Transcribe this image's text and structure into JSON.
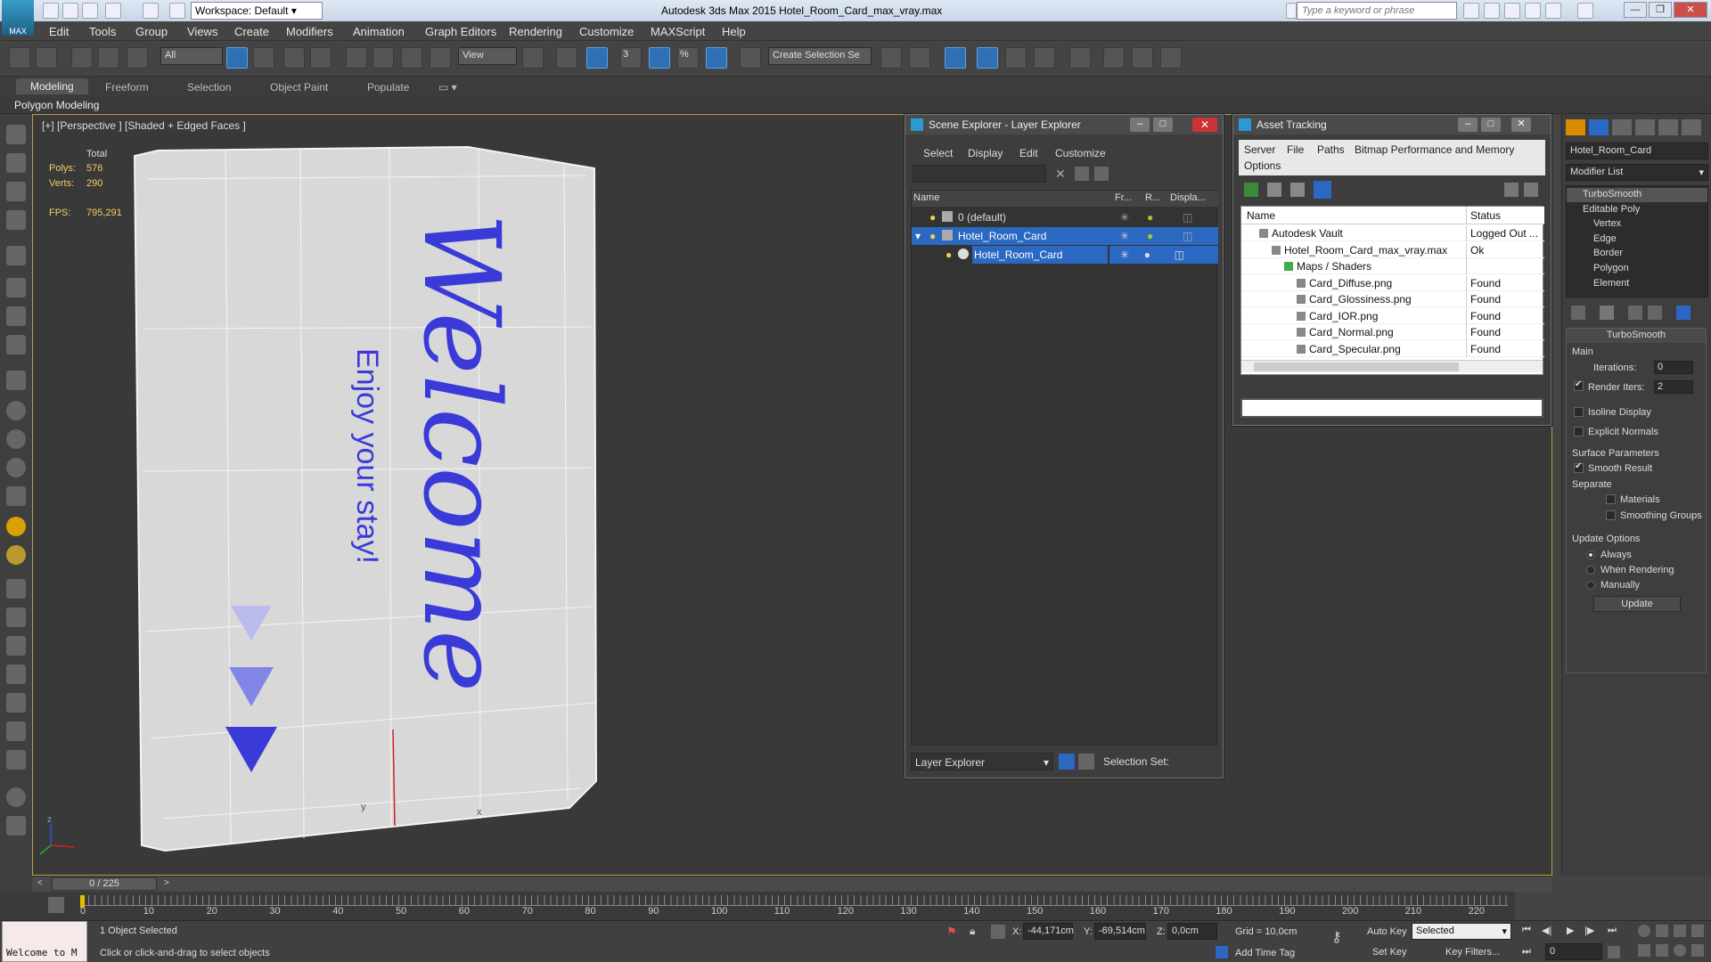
{
  "app": {
    "title": "Autodesk 3ds Max 2015    Hotel_Room_Card_max_vray.max",
    "logo": "MAX",
    "workspace": "Workspace: Default",
    "search_placeholder": "Type a keyword or phrase"
  },
  "menubar": [
    "Edit",
    "Tools",
    "Group",
    "Views",
    "Create",
    "Modifiers",
    "Animation",
    "Graph Editors",
    "Rendering",
    "Customize",
    "MAXScript",
    "Help"
  ],
  "toolbar": {
    "filter": "All",
    "refcoord": "View",
    "snaps": [
      "3",
      "%"
    ],
    "named_sel": "Create Selection Se"
  },
  "ribbon": {
    "tabs": [
      "Modeling",
      "Freeform",
      "Selection",
      "Object Paint",
      "Populate"
    ],
    "active": "Modeling",
    "panel": "Polygon Modeling"
  },
  "viewport": {
    "label": "[+] [Perspective ] [Shaded + Edged Faces ]",
    "stats": {
      "total_label": "Total",
      "polys_label": "Polys:",
      "polys": "576",
      "verts_label": "Verts:",
      "verts": "290",
      "fps_label": "FPS:",
      "fps": "795,291"
    },
    "card": {
      "title": "Welcome",
      "subtitle": "Enjoy your stay!",
      "accent": "#3a3ad8"
    },
    "axis": {
      "x": "x",
      "y": "y",
      "z": "z"
    }
  },
  "scene_explorer": {
    "title": "Scene Explorer - Layer Explorer",
    "menu": [
      "Select",
      "Display",
      "Edit",
      "Customize"
    ],
    "columns": [
      "Name",
      "Fr...",
      "R...",
      "Displa..."
    ],
    "rows": [
      {
        "name": "0 (default)",
        "level": 0,
        "selected": false
      },
      {
        "name": "Hotel_Room_Card",
        "level": 0,
        "selected": true
      },
      {
        "name": "Hotel_Room_Card",
        "level": 1,
        "selected": true
      }
    ],
    "footer_mode": "Layer Explorer",
    "footer_sel": "Selection Set:"
  },
  "asset_tracking": {
    "title": "Asset Tracking",
    "menu": [
      "Server",
      "File",
      "Paths",
      "Bitmap Performance and Memory",
      "Options"
    ],
    "columns": [
      "Name",
      "Status"
    ],
    "rows": [
      {
        "name": "Autodesk Vault",
        "status": "Logged Out ...",
        "level": 0
      },
      {
        "name": "Hotel_Room_Card_max_vray.max",
        "status": "Ok",
        "level": 1
      },
      {
        "name": "Maps / Shaders",
        "status": "",
        "level": 2
      },
      {
        "name": "Card_Diffuse.png",
        "status": "Found",
        "level": 3
      },
      {
        "name": "Card_Glossiness.png",
        "status": "Found",
        "level": 3
      },
      {
        "name": "Card_IOR.png",
        "status": "Found",
        "level": 3
      },
      {
        "name": "Card_Normal.png",
        "status": "Found",
        "level": 3
      },
      {
        "name": "Card_Specular.png",
        "status": "Found",
        "level": 3
      }
    ]
  },
  "command_panel": {
    "object_name": "Hotel_Room_Card",
    "modifier_list": "Modifier List",
    "stack": [
      "TurboSmooth",
      "Editable Poly",
      "Vertex",
      "Edge",
      "Border",
      "Polygon",
      "Element"
    ],
    "rollout_title": "TurboSmooth",
    "main_label": "Main",
    "iterations_label": "Iterations:",
    "iterations": "0",
    "render_iters_label": "Render Iters:",
    "render_iters": "2",
    "isoline": "Isoline Display",
    "explicit_normals": "Explicit Normals",
    "surface_params": "Surface Parameters",
    "smooth_result": "Smooth Result",
    "separate": "Separate",
    "materials": "Materials",
    "smoothing_groups": "Smoothing Groups",
    "update_options": "Update Options",
    "always": "Always",
    "when_rendering": "When Rendering",
    "manually": "Manually",
    "update_btn": "Update"
  },
  "timeline": {
    "frame": "0 / 225",
    "ticks": [
      "0",
      "10",
      "20",
      "30",
      "40",
      "50",
      "60",
      "70",
      "80",
      "90",
      "100",
      "110",
      "120",
      "130",
      "140",
      "150",
      "160",
      "170",
      "180",
      "190",
      "200",
      "210",
      "220"
    ]
  },
  "status": {
    "script": "Welcome to M",
    "selected": "1 Object Selected",
    "prompt": "Click or click-and-drag to select objects",
    "x_label": "X:",
    "x": "-44,171cm",
    "y_label": "Y:",
    "y": "-69,514cm",
    "z_label": "Z:",
    "z": "0,0cm",
    "grid": "Grid = 10,0cm",
    "add_time_tag": "Add Time Tag",
    "auto_key": "Auto Key",
    "set_key": "Set Key",
    "key_mode": "Selected",
    "key_filters": "Key Filters...",
    "frame": "0"
  }
}
